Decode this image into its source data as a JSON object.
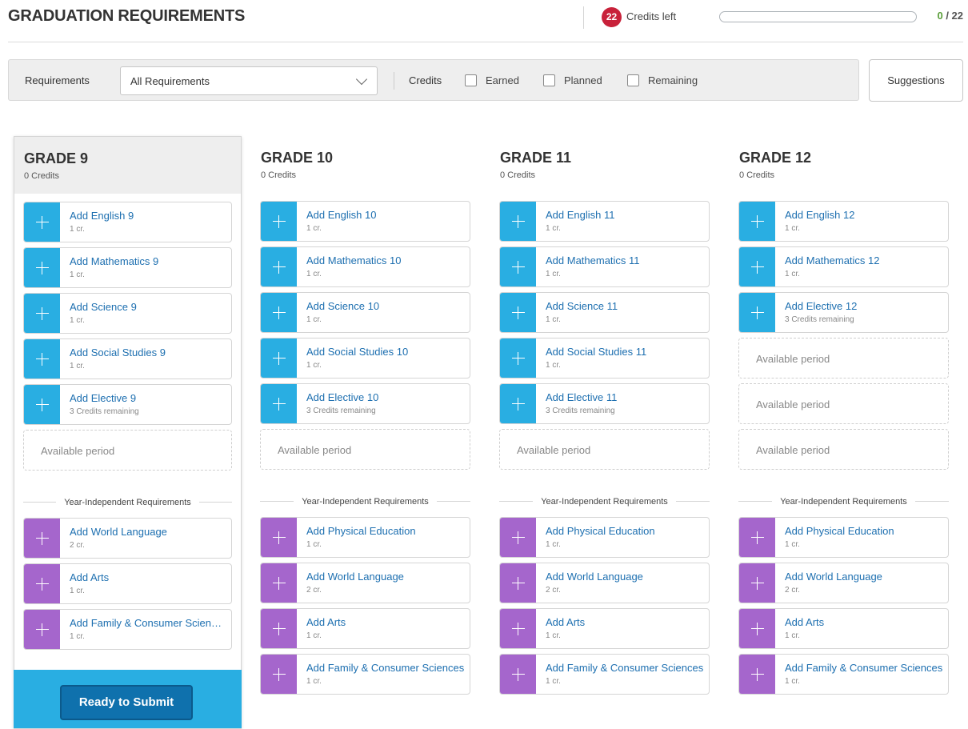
{
  "header": {
    "title": "GRADUATION REQUIREMENTS",
    "credits_left_count": "22",
    "credits_left_label": "Credits left",
    "progress_earned": "0",
    "progress_total": "/ 22",
    "progress_fraction": 0
  },
  "filters": {
    "requirements_label": "Requirements",
    "requirements_value": "All Requirements",
    "credits_label": "Credits",
    "earned_label": "Earned",
    "planned_label": "Planned",
    "remaining_label": "Remaining",
    "suggestions_label": "Suggestions"
  },
  "colors": {
    "accent_blue": "#29aee2",
    "accent_purple": "#a566cc",
    "badge_red": "#c8213a",
    "link_blue": "#1d6fb0",
    "submit_blue": "#0f71ad"
  },
  "year_independent_label": "Year-Independent Requirements",
  "available_period_label": "Available period",
  "submit_label": "Ready to Submit",
  "grades": [
    {
      "title": "GRADE 9",
      "credits": "0 Credits",
      "courses": [
        {
          "title": "Add English 9",
          "sub": "1 cr."
        },
        {
          "title": "Add Mathematics 9",
          "sub": "1 cr."
        },
        {
          "title": "Add Science 9",
          "sub": "1 cr."
        },
        {
          "title": "Add Social Studies 9",
          "sub": "1 cr."
        },
        {
          "title": "Add Elective 9",
          "sub": "3 Credits remaining"
        }
      ],
      "empty_slots": 1,
      "independent": [
        {
          "title": "Add World Language",
          "sub": "2 cr."
        },
        {
          "title": "Add Arts",
          "sub": "1 cr."
        },
        {
          "title": "Add Family & Consumer Sciences",
          "sub": "1 cr."
        }
      ]
    },
    {
      "title": "GRADE 10",
      "credits": "0 Credits",
      "courses": [
        {
          "title": "Add English 10",
          "sub": "1 cr."
        },
        {
          "title": "Add Mathematics 10",
          "sub": "1 cr."
        },
        {
          "title": "Add Science 10",
          "sub": "1 cr."
        },
        {
          "title": "Add Social Studies 10",
          "sub": "1 cr."
        },
        {
          "title": "Add Elective 10",
          "sub": "3 Credits remaining"
        }
      ],
      "empty_slots": 1,
      "independent": [
        {
          "title": "Add Physical Education",
          "sub": "1 cr."
        },
        {
          "title": "Add World Language",
          "sub": "2 cr."
        },
        {
          "title": "Add Arts",
          "sub": "1 cr."
        },
        {
          "title": "Add Family & Consumer Sciences",
          "sub": "1 cr."
        }
      ]
    },
    {
      "title": "GRADE 11",
      "credits": "0 Credits",
      "courses": [
        {
          "title": "Add English 11",
          "sub": "1 cr."
        },
        {
          "title": "Add Mathematics 11",
          "sub": "1 cr."
        },
        {
          "title": "Add Science 11",
          "sub": "1 cr."
        },
        {
          "title": "Add Social Studies 11",
          "sub": "1 cr."
        },
        {
          "title": "Add Elective 11",
          "sub": "3 Credits remaining"
        }
      ],
      "empty_slots": 1,
      "independent": [
        {
          "title": "Add Physical Education",
          "sub": "1 cr."
        },
        {
          "title": "Add World Language",
          "sub": "2 cr."
        },
        {
          "title": "Add Arts",
          "sub": "1 cr."
        },
        {
          "title": "Add Family & Consumer Sciences",
          "sub": "1 cr."
        }
      ]
    },
    {
      "title": "GRADE 12",
      "credits": "0 Credits",
      "courses": [
        {
          "title": "Add English 12",
          "sub": "1 cr."
        },
        {
          "title": "Add Mathematics 12",
          "sub": "1 cr."
        },
        {
          "title": "Add Elective 12",
          "sub": "3 Credits remaining"
        }
      ],
      "empty_slots": 3,
      "independent": [
        {
          "title": "Add Physical Education",
          "sub": "1 cr."
        },
        {
          "title": "Add World Language",
          "sub": "2 cr."
        },
        {
          "title": "Add Arts",
          "sub": "1 cr."
        },
        {
          "title": "Add Family & Consumer Sciences",
          "sub": "1 cr."
        }
      ]
    }
  ]
}
